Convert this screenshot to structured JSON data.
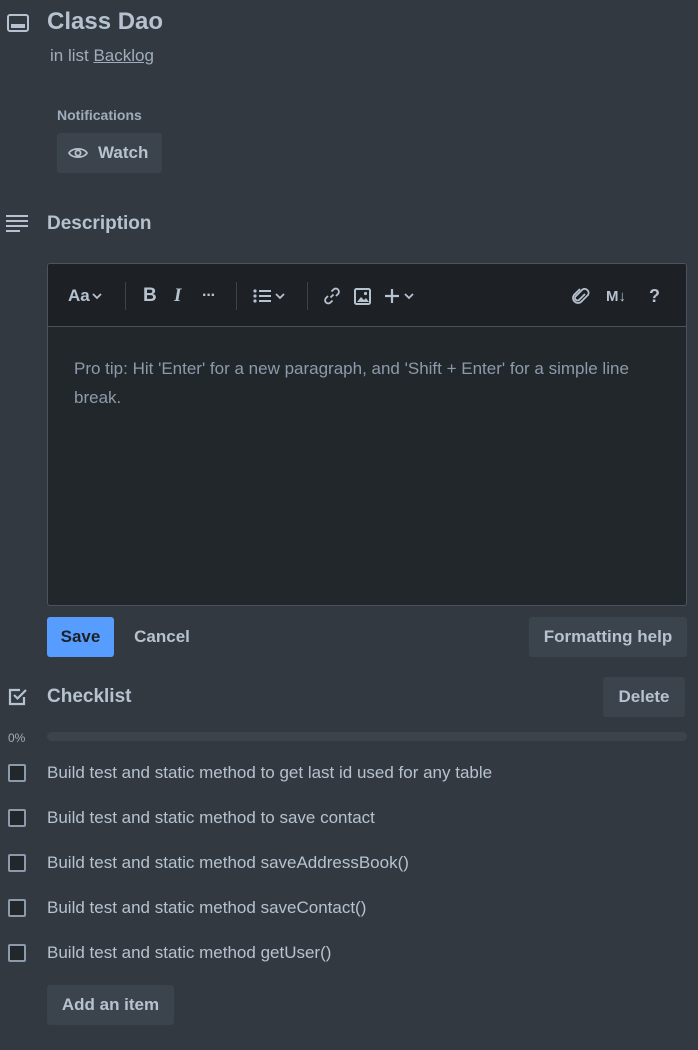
{
  "card": {
    "title": "Class Dao",
    "in_list_prefix": "in list",
    "list_name": "Backlog"
  },
  "notifications": {
    "label": "Notifications",
    "watch_label": "Watch"
  },
  "description": {
    "title": "Description",
    "toolbar": {
      "text_style_label": "Aa",
      "more_label": "···",
      "markdown_label": "M↓",
      "help_label": "?"
    },
    "placeholder": "Pro tip: Hit 'Enter' for a new paragraph, and 'Shift + Enter' for a simple line break.",
    "save_label": "Save",
    "cancel_label": "Cancel",
    "formatting_help_label": "Formatting help"
  },
  "checklist": {
    "title": "Checklist",
    "delete_label": "Delete",
    "progress_text": "0%",
    "progress_value": 0,
    "items": [
      {
        "label": "Build test and static method to get last id used for any table",
        "checked": false
      },
      {
        "label": "Build test and static method to save contact",
        "checked": false
      },
      {
        "label": "Build test and static method saveAddressBook()",
        "checked": false
      },
      {
        "label": "Build test and static method saveContact()",
        "checked": false
      },
      {
        "label": "Build test and static method getUser()",
        "checked": false
      }
    ],
    "add_item_label": "Add an item"
  },
  "colors": {
    "accent": "#579dff",
    "background": "#323940",
    "button_bg": "#3b444c",
    "editor_bg": "#22272b",
    "text": "#b6c2cf"
  },
  "icons": {
    "card": "card-icon",
    "watch": "eye-icon",
    "description": "description-lines-icon",
    "checklist": "checkbox-checked-icon"
  }
}
